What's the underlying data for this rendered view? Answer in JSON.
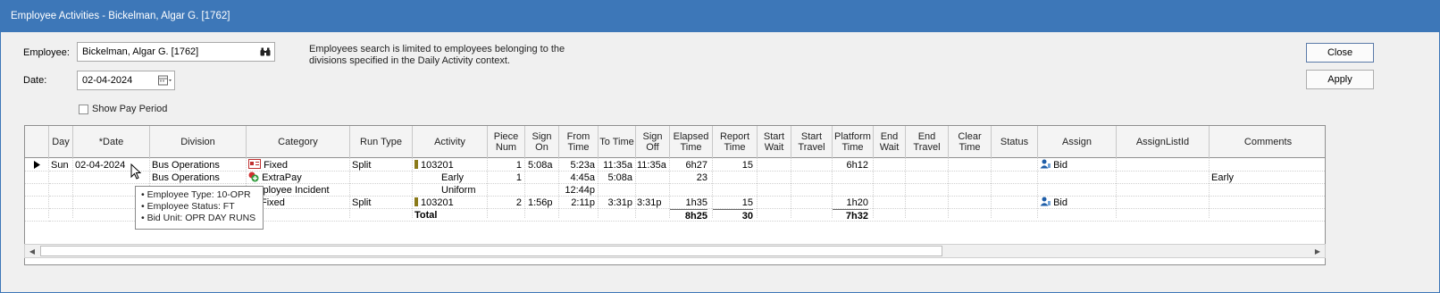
{
  "window": {
    "title": "Employee Activities - Bickelman, Algar G.  [1762]"
  },
  "form": {
    "employee_label": "Employee:",
    "employee_value": "Bickelman, Algar G.  [1762]",
    "date_label": "Date:",
    "date_value": "02-04-2024",
    "show_pay_period_label": "Show Pay Period",
    "note": "Employees search is limited to employees belonging to the divisions specified in the Daily Activity context."
  },
  "buttons": {
    "close": "Close",
    "apply": "Apply"
  },
  "grid": {
    "columns": [
      "Day",
      "*Date",
      "Division",
      "Category",
      "Run Type",
      "Activity",
      "Piece Num",
      "Sign On",
      "From Time",
      "To Time",
      "Sign Off",
      "Elapsed Time",
      "Report Time",
      "Start Wait",
      "Start Travel",
      "Platform Time",
      "End Wait",
      "End Travel",
      "Clear Time",
      "Status",
      "Assign",
      "AssignListId",
      "Comments"
    ],
    "rows": [
      {
        "day": "Sun",
        "date": "02-04-2024",
        "division": "Bus Operations",
        "category": "Fixed",
        "run_type": "Split",
        "activity": "103201",
        "piece": "1",
        "sign_on": "5:08a",
        "from": "5:23a",
        "to": "11:35a",
        "sign_off": "11:35a",
        "elapsed": "6h27",
        "report": "15",
        "platform": "6h12",
        "assign": "Bid",
        "comments": ""
      },
      {
        "day": "",
        "date": "",
        "division": "Bus Operations",
        "category": "ExtraPay",
        "run_type": "",
        "activity": "Early",
        "piece": "1",
        "sign_on": "",
        "from": "4:45a",
        "to": "5:08a",
        "sign_off": "",
        "elapsed": "23",
        "report": "",
        "platform": "",
        "assign": "",
        "comments": "Early"
      },
      {
        "day": "",
        "date": "",
        "division": "",
        "category": "Employee Incident",
        "run_type": "",
        "activity": "Uniform",
        "piece": "",
        "sign_on": "",
        "from": "12:44p",
        "to": "",
        "sign_off": "",
        "elapsed": "",
        "report": "",
        "platform": "",
        "assign": "",
        "comments": ""
      },
      {
        "day": "",
        "date": "",
        "division": "",
        "category": "Fixed",
        "run_type": "Split",
        "activity": "103201",
        "piece": "2",
        "sign_on": "1:56p",
        "from": "2:11p",
        "to": "3:31p",
        "sign_off": "3:31p",
        "elapsed": "1h35",
        "report": "15",
        "platform": "1h20",
        "assign": "Bid",
        "comments": ""
      }
    ],
    "total": {
      "label": "Total",
      "elapsed": "8h25",
      "report": "30",
      "platform": "7h32"
    }
  },
  "tooltip": {
    "lines": [
      "• Employee Type: 10-OPR",
      "• Employee Status: FT",
      "• Bid Unit: OPR DAY RUNS"
    ]
  },
  "colors": {
    "titlebar": "#3d77b8",
    "background": "#f0f0f0"
  },
  "icons": {
    "search": "binoculars-icon",
    "calendar": "calendar-icon",
    "fixed": "fixed-category-icon",
    "extrapay": "extrapay-icon",
    "assign": "person-icon"
  }
}
